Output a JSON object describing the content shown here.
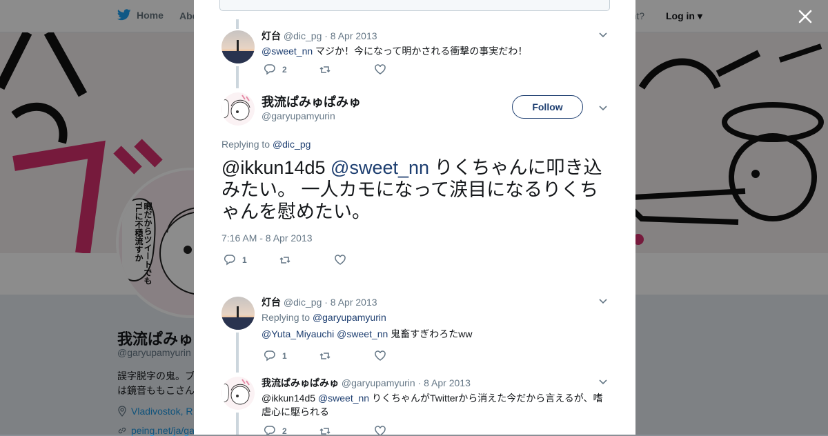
{
  "nav": {
    "home_label": "Home",
    "about_label": "Abo",
    "account_prompt": "ccount?",
    "login_label": "Log in",
    "brand_color": "#1da1f2"
  },
  "profile_bg": {
    "name": "我流ぱみゅぱ",
    "handle": "@garyupamyurin",
    "bio_line1": "誤字脱字の鬼。プ",
    "bio_line2": "は鏡音ももこさん",
    "location": "Vladivostok, R",
    "url": "peing.net/ja/ga",
    "avatar_caption": "暇だからツイートでもTLに不穏流すか"
  },
  "thread": {
    "parent_tweet": {
      "name": "灯台",
      "handle": "@dic_pg",
      "date": "· 8 Apr 2013",
      "mention": "@sweet_nn",
      "text": " マジか！今になって明かされる衝撃の事実だわ！",
      "reply_count": "2"
    },
    "main_tweet": {
      "name": "我流ぱみゅぱみゅ",
      "handle": "@garyupamyurin",
      "follow_label": "Follow",
      "replying_prefix": "Replying to ",
      "replying_to": "@dic_pg",
      "mention1": "@ikkun14d5",
      "mention2": "@sweet_nn",
      "text": " りくちゃんに叩き込みたい。 一人カモになって涙目になるりくちゃんを慰めたい。",
      "timestamp": "7:16 AM - 8 Apr 2013",
      "reply_count": "1"
    },
    "reply1": {
      "name": "灯台",
      "handle": "@dic_pg",
      "date": "· 8 Apr 2013",
      "replying_prefix": "Replying to ",
      "replying_to": "@garyupamyurin",
      "mention1": "@Yuta_Miyauchi",
      "mention2": "@sweet_nn",
      "text": " 鬼畜すぎわろたww",
      "reply_count": "1"
    },
    "reply2": {
      "name": "我流ぱみゅぱみゅ",
      "handle": "@garyupamyurin",
      "date": "· 8 Apr 2013",
      "mention1": "@ikkun14d5",
      "mention2": "@sweet_nn",
      "text": " りくちゃんがTwitterから消えた今だから言えるが、嗜虐心に駆られる",
      "reply_count": "2"
    }
  },
  "colors": {
    "link": "#1d3e70",
    "muted": "#657786",
    "thread_line": "#ccd6dd"
  }
}
